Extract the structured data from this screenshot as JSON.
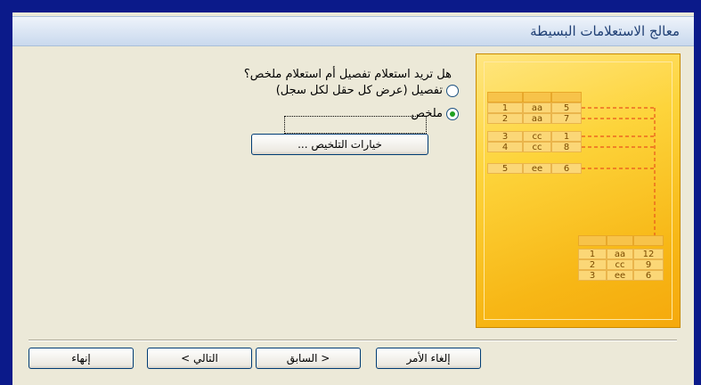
{
  "window": {
    "title": "معالج الاستعلامات البسيطة"
  },
  "question": {
    "text": "هل تريد استعلام تفصيل أم استعلام ملخص؟"
  },
  "options": {
    "detail_label": "تفصيل (عرض كل حقل لكل سجل)",
    "summary_label": "ملخص",
    "selected": "summary"
  },
  "summary_options_button": {
    "label": "خيارات التلخيص ..."
  },
  "illustration": {
    "source_rows": [
      [
        "1",
        "aa",
        "5"
      ],
      [
        "2",
        "aa",
        "7"
      ],
      [
        "3",
        "cc",
        "1"
      ],
      [
        "4",
        "cc",
        "8"
      ],
      [
        "5",
        "ee",
        "6"
      ]
    ],
    "summary_rows": [
      [
        "1",
        "aa",
        "12"
      ],
      [
        "2",
        "cc",
        "9"
      ],
      [
        "3",
        "ee",
        "6"
      ]
    ]
  },
  "footer": {
    "cancel_label": "إلغاء الأمر",
    "back_label": "< السابق",
    "next_label": "التالي >",
    "finish_label": "إنهاء"
  },
  "colors": {
    "frame": "#0b1a8a",
    "dialog_bg": "#ece9d8",
    "illustration": "#fdd43b",
    "radio_dot": "#21a121"
  }
}
